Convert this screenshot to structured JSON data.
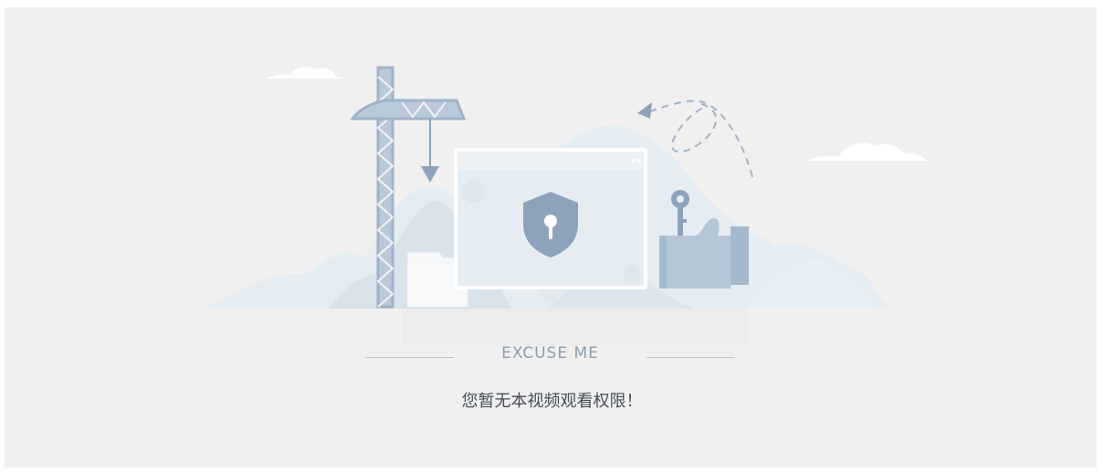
{
  "notice": {
    "heading": "EXCUSE ME",
    "message": "您暂无本视频观看权限！"
  },
  "illustration": {
    "description_icons": [
      "cloud-icon",
      "crane-icon",
      "shield-lock-icon",
      "hand-key-icon",
      "folder-icon",
      "curved-arrow-icon"
    ]
  },
  "colors": {
    "background": "#f0f0f0",
    "accent": "#8ea3bb",
    "heading_text": "#8e9cad",
    "message_text": "#464d58"
  }
}
